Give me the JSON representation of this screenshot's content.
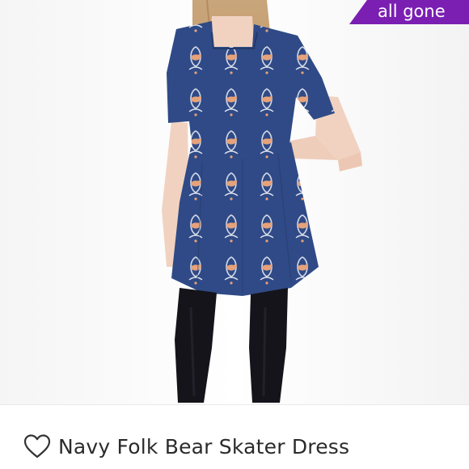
{
  "listing": {
    "badge": "all gone",
    "title": "Navy Folk Bear Skater Dress",
    "photo_alt": "Model wearing a navy dress with bear print",
    "like_icon": "heart-outline-icon"
  },
  "colors": {
    "badge_bg": "#7b1fb3",
    "dress_navy": "#2f4a86",
    "print_peach": "#e6a27a",
    "tights": "#15141a"
  }
}
